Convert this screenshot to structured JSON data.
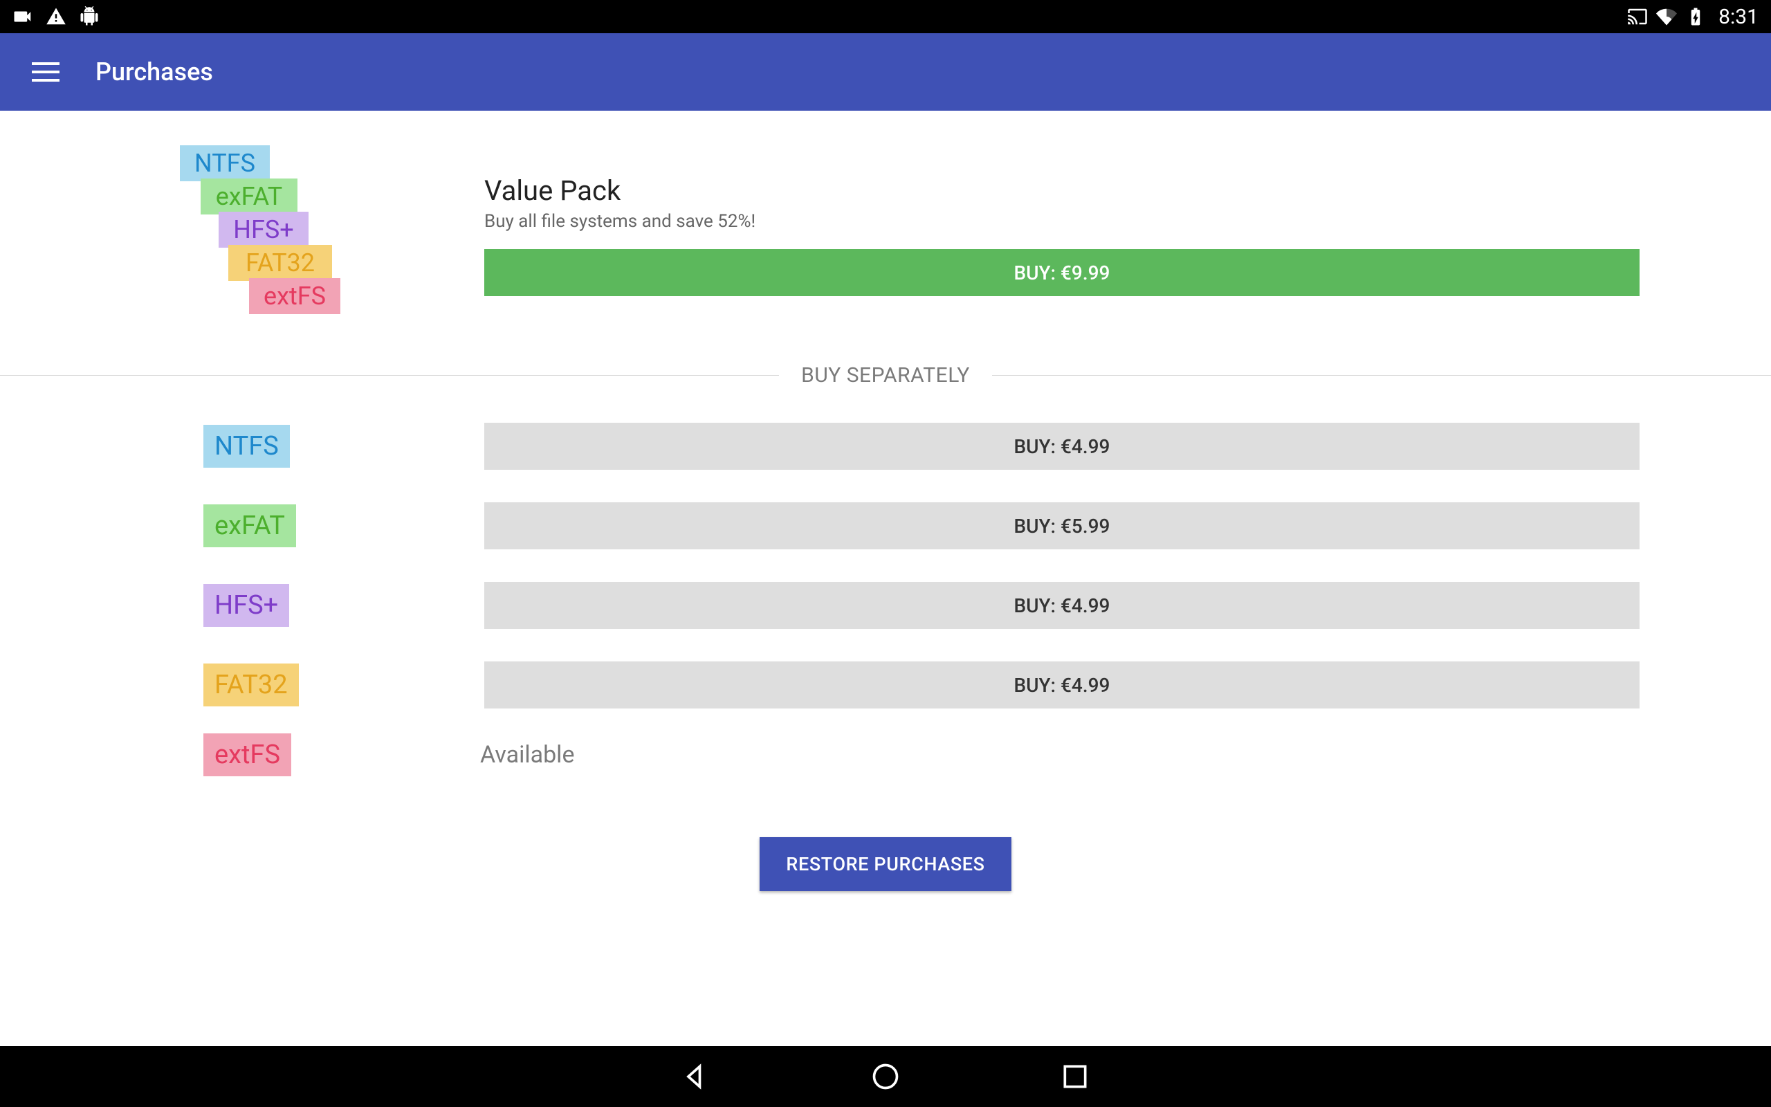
{
  "status_bar": {
    "clock": "8:31"
  },
  "app_bar": {
    "title": "Purchases"
  },
  "pack": {
    "title": "Value Pack",
    "subtitle": "Buy all file systems and save 52%!",
    "buy_label": "BUY: €9.99",
    "logo_chips": [
      "NTFS",
      "exFAT",
      "HFS+",
      "FAT32",
      "extFS"
    ]
  },
  "separator_label": "BUY SEPARATELY",
  "fs_items": [
    {
      "name": "NTFS",
      "buy_label": "BUY: €4.99",
      "available": false
    },
    {
      "name": "exFAT",
      "buy_label": "BUY: €5.99",
      "available": false
    },
    {
      "name": "HFS+",
      "buy_label": "BUY: €4.99",
      "available": false
    },
    {
      "name": "FAT32",
      "buy_label": "BUY: €4.99",
      "available": false
    },
    {
      "name": "extFS",
      "buy_label": "",
      "available": true,
      "available_label": "Available"
    }
  ],
  "restore_label": "RESTORE PURCHASES",
  "colors": {
    "primary": "#3f51b5",
    "buy_green": "#5cb85c",
    "buy_grey": "#dedede"
  }
}
